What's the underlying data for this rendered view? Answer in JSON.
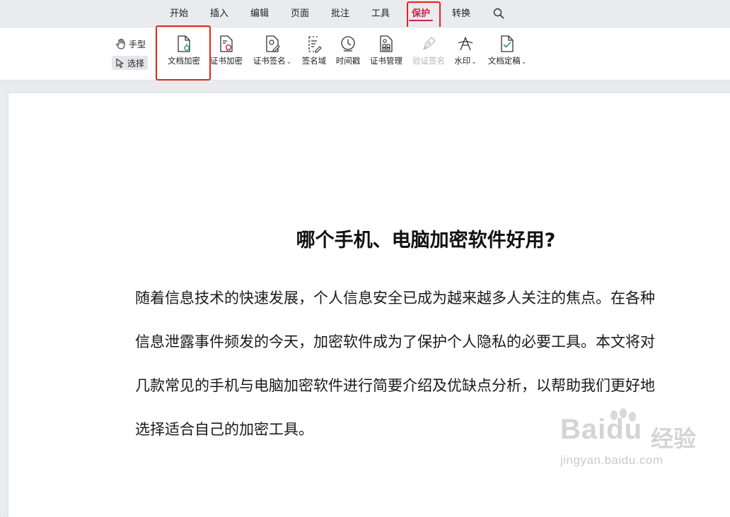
{
  "menu": {
    "tabs": [
      {
        "label": "开始"
      },
      {
        "label": "插入"
      },
      {
        "label": "编辑"
      },
      {
        "label": "页面"
      },
      {
        "label": "批注"
      },
      {
        "label": "工具"
      },
      {
        "label": "保护",
        "active": true
      },
      {
        "label": "转换"
      }
    ],
    "search_icon": "search-icon"
  },
  "ribbon": {
    "hand_tool": "手型",
    "select_tool": "选择",
    "tools": [
      {
        "label": "文档加密",
        "icon": "document-lock-icon"
      },
      {
        "label": "证书加密",
        "icon": "certificate-lock-icon"
      },
      {
        "label": "证书签名",
        "icon": "certificate-sign-icon",
        "dropdown": true
      },
      {
        "label": "签名域",
        "icon": "signature-field-icon"
      },
      {
        "label": "时间戳",
        "icon": "timestamp-icon"
      },
      {
        "label": "证书管理",
        "icon": "certificate-manage-icon"
      },
      {
        "label": "验证签名",
        "icon": "verify-signature-icon",
        "disabled": true
      },
      {
        "label": "水印",
        "icon": "watermark-icon",
        "dropdown": true
      },
      {
        "label": "文档定稿",
        "icon": "finalize-document-icon",
        "dropdown": true
      }
    ]
  },
  "document": {
    "title": "哪个手机、电脑加密软件好用?",
    "paragraph_lines": [
      "随着信息技术的快速发展，个人信息安全已成为越来越多人关注的焦点。在各种",
      "信息泄露事件频发的今天，加密软件成为了保护个人隐私的必要工具。本文将对",
      "几款常见的手机与电脑加密软件进行简要介绍及优缺点分析，以帮助我们更好地",
      "选择适合自己的加密工具。"
    ]
  },
  "watermark": {
    "brand": "Baidu",
    "cn": "经验",
    "url": "jingyan.baidu.com"
  },
  "colors": {
    "accent": "#c7254e",
    "highlight_box": "#e1261c",
    "toolbar_bg": "#e9ebee"
  }
}
